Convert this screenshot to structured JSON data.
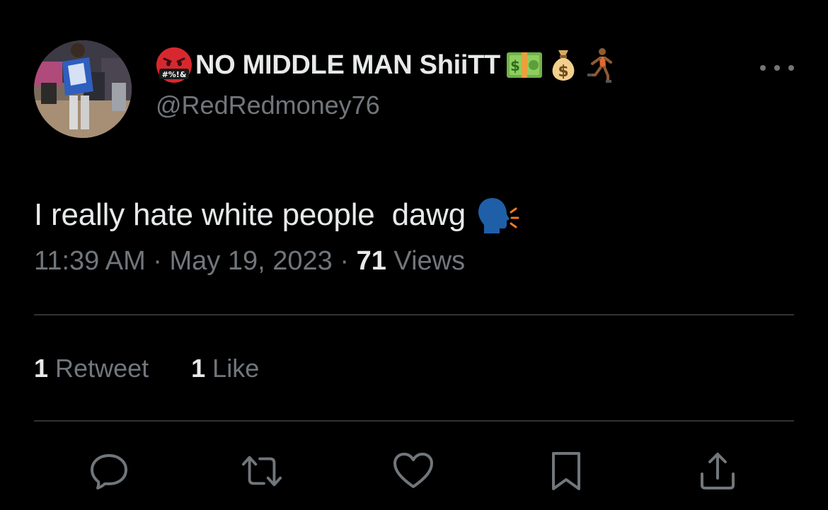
{
  "author": {
    "display_name": "NO MIDDLE MAN ShiiTT",
    "handle": "@RedRedmoney76",
    "name_prefix_emoji": "face-with-symbols-on-mouth-icon",
    "name_suffix_emojis": [
      "dollar-banknote-icon",
      "money-bag-icon",
      "person-running-icon"
    ]
  },
  "tweet": {
    "text": "I really hate white people  dawg",
    "trailing_emoji": "speaking-head-icon"
  },
  "meta": {
    "time": "11:39 AM",
    "separator": " · ",
    "date": "May 19, 2023",
    "views_count": "71",
    "views_label": "Views"
  },
  "stats": {
    "retweets_count": "1",
    "retweets_label": "Retweet",
    "likes_count": "1",
    "likes_label": "Like"
  },
  "actions": [
    {
      "name": "reply",
      "icon": "reply-icon"
    },
    {
      "name": "retweet",
      "icon": "retweet-icon"
    },
    {
      "name": "like",
      "icon": "heart-icon"
    },
    {
      "name": "bookmark",
      "icon": "bookmark-icon"
    },
    {
      "name": "share",
      "icon": "share-icon"
    }
  ],
  "colors": {
    "background": "#000000",
    "primary_text": "#e7e9ea",
    "secondary_text": "#71767b",
    "divider": "#2f3336"
  }
}
